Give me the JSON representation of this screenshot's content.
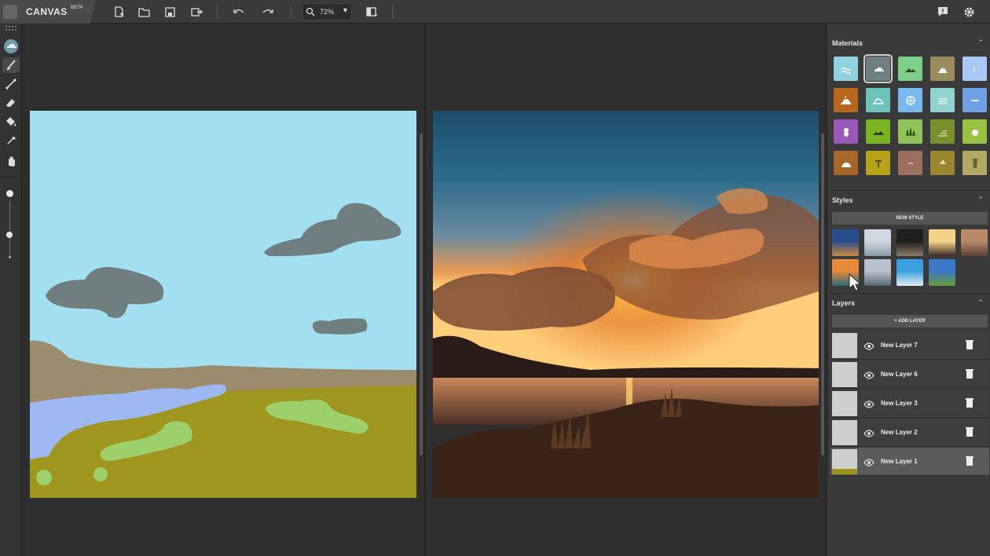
{
  "app": {
    "name": "CANVAS",
    "badge": "BETA"
  },
  "toolbar": {
    "zoom_value": "72%",
    "zoom_arrow": "▼",
    "icons": [
      "new-file-icon",
      "open-folder-icon",
      "save-icon",
      "export-icon",
      "undo-icon",
      "redo-icon",
      "zoom-icon",
      "toggle-panel-icon",
      "feedback-icon",
      "settings-icon"
    ]
  },
  "tools": [
    "material-brush-icon",
    "brush-icon",
    "line-icon",
    "eraser-icon",
    "fill-icon",
    "eyedropper-icon",
    "pan-hand-icon"
  ],
  "materials": {
    "title": "Materials",
    "collapse_icon": "chevron-up-icon",
    "swatches": [
      {
        "color": "#8fd3e0",
        "icon": "water-icon"
      },
      {
        "color": "#6f7f80",
        "icon": "cloud-icon"
      },
      {
        "color": "#7ecf8a",
        "icon": "hill-icon"
      },
      {
        "color": "#9a8c5c",
        "icon": "mountain-icon"
      },
      {
        "color": "#a9c8f5",
        "icon": "sky-icon"
      },
      {
        "color": "#b8651e",
        "icon": "volcano-icon"
      },
      {
        "color": "#6cc3b9",
        "icon": "dome-icon"
      },
      {
        "color": "#7ab9f0",
        "icon": "snowflake-icon"
      },
      {
        "color": "#8ed3cd",
        "icon": "waves-icon"
      },
      {
        "color": "#6ea0e6",
        "icon": "fog-icon"
      },
      {
        "color": "#9a58b8",
        "icon": "flower-icon"
      },
      {
        "color": "#78b320",
        "icon": "field-icon"
      },
      {
        "color": "#8fc35a",
        "icon": "grass-icon"
      },
      {
        "color": "#7a8f2b",
        "icon": "dirt-icon"
      },
      {
        "color": "#9ac242",
        "icon": "bush-icon"
      },
      {
        "color": "#a8662a",
        "icon": "rock-icon"
      },
      {
        "color": "#b8a217",
        "icon": "palm-icon"
      },
      {
        "color": "#9a6f5f",
        "icon": "stone-icon"
      },
      {
        "color": "#9b8630",
        "icon": "tree-icon"
      },
      {
        "color": "#b4a964",
        "icon": "tower-icon"
      }
    ]
  },
  "styles": {
    "title": "Styles",
    "new_style_label": "NEW STYLE",
    "collapse_icon": "chevron-up-icon",
    "thumbs": [
      {
        "top": "#2a4d8f",
        "bottom": "#c98a3b"
      },
      {
        "top": "#cfd8e0",
        "bottom": "#8a9aa6"
      },
      {
        "top": "#1e1e1e",
        "bottom": "#8c7a68"
      },
      {
        "top": "#f3d28a",
        "bottom": "#3a2a2a"
      },
      {
        "top": "#b88a6a",
        "bottom": "#5a3f2f"
      },
      {
        "top": "#e98a3a",
        "bottom": "#2a6a7a"
      },
      {
        "top": "#b7c2cc",
        "bottom": "#5a6670"
      },
      {
        "top": "#3aa0e0",
        "bottom": "#e6eef2"
      },
      {
        "top": "#3b78c8",
        "bottom": "#6a9a3a"
      }
    ]
  },
  "layers": {
    "title": "Layers",
    "add_label": "+ ADD LAYER",
    "collapse_icon": "chevron-up-icon",
    "items": [
      {
        "name": "New Layer 7",
        "active": false
      },
      {
        "name": "New Layer 6",
        "active": false
      },
      {
        "name": "New Layer 3",
        "active": false
      },
      {
        "name": "New Layer 2",
        "active": false
      },
      {
        "name": "New Layer 1",
        "active": true
      }
    ]
  },
  "colors": {
    "sky": "#a2dff0",
    "cloud": "#6f7f80",
    "ground": "#9f9620",
    "dirt": "#9a8c6c",
    "water": "#9db8f2",
    "grass": "#9dcf6a"
  }
}
